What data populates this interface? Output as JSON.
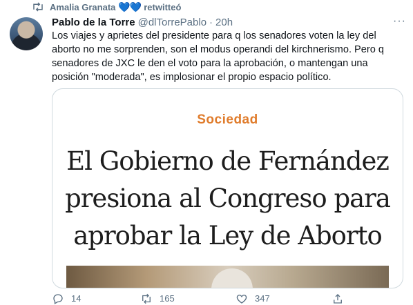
{
  "retweet_bar": {
    "user": "Amalia Granata",
    "hearts": "💙💙",
    "action": "retwitteó"
  },
  "tweet": {
    "author_name": "Pablo de la Torre",
    "handle": "@dlTorrePablo",
    "separator": "·",
    "time": "20h",
    "text": "Los viajes y aprietes del presidente para q los senadores voten la ley del\naborto no me sorprenden, son el modus operandi del kirchnerismo. Pero q\nsenadores de JXC le den el voto para la aprobación, o mantengan una\nposición \"moderada\", es implosionar el propio espacio político."
  },
  "card": {
    "section": "Sociedad",
    "headline_line1": "El Gobierno de Fernández",
    "headline_line2": "presiona al Congreso para",
    "headline_line3": "aprobar la Ley de Aborto"
  },
  "actions": {
    "reply_count": "14",
    "retweet_count": "165",
    "like_count": "347"
  },
  "icons": {
    "retweet": "retweet-icon",
    "more": "more-icon",
    "reply": "reply-icon",
    "like": "heart-icon",
    "share": "share-icon"
  },
  "colors": {
    "secondary_text": "#5b7083",
    "section_orange": "#e07c2c",
    "border": "#cfd9de"
  }
}
